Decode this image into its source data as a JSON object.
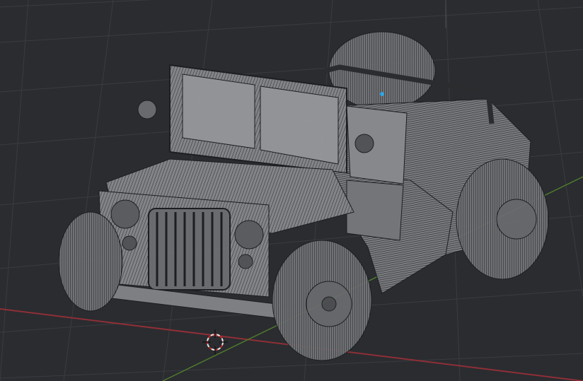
{
  "app": "3D viewport",
  "viewport": {
    "shading": "wireframe-xray",
    "background_color": "#2a2c30",
    "grid_color": "#3a3c41",
    "x_axis_color": "#8f2f36",
    "y_axis_color": "#4f7a2c",
    "mesh_fill": "#8b8d90",
    "mesh_line": "#1c1d20",
    "origin_color": "#2fa6e6"
  },
  "object": {
    "name_icon": "jeep-mesh",
    "origin_marker": "object-origin-dot"
  },
  "cursor": {
    "icon": "3d-cursor-icon"
  }
}
